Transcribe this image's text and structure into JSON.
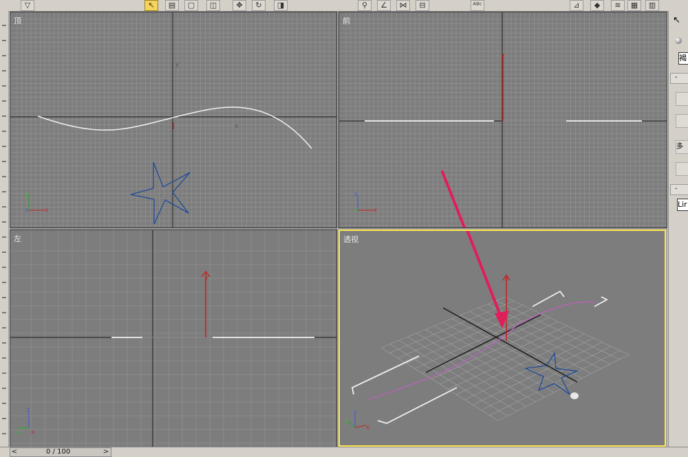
{
  "toolbar": {
    "buttons": [
      {
        "name": "select-filter-icon",
        "glyph": "▽"
      },
      {
        "name": "select-object-icon",
        "glyph": "↖"
      },
      {
        "name": "select-by-name-icon",
        "glyph": "▤"
      },
      {
        "name": "rect-selection-icon",
        "glyph": "▢"
      },
      {
        "name": "window-crossing-icon",
        "glyph": "◫"
      },
      {
        "name": "move-icon",
        "glyph": "✥"
      },
      {
        "name": "rotate-icon",
        "glyph": "↻"
      },
      {
        "name": "scale-icon",
        "glyph": "◨"
      },
      {
        "name": "snap-icon",
        "glyph": "⚲"
      },
      {
        "name": "angle-snap-icon",
        "glyph": "∠"
      },
      {
        "name": "mirror-icon",
        "glyph": "⋈"
      },
      {
        "name": "align-icon",
        "glyph": "⊟"
      },
      {
        "name": "spell-icon",
        "glyph": "ᴬᴮᶜ"
      },
      {
        "name": "curve-editor-icon",
        "glyph": "⊿"
      },
      {
        "name": "schematic-icon",
        "glyph": "◆"
      },
      {
        "name": "material-editor-icon",
        "glyph": "≋"
      },
      {
        "name": "render-setup-icon",
        "glyph": "▦"
      },
      {
        "name": "render-icon",
        "glyph": "▥"
      }
    ]
  },
  "viewports": {
    "top": {
      "label": "顶"
    },
    "front": {
      "label": "前"
    },
    "left": {
      "label": "左"
    },
    "perspective": {
      "label": "透视"
    }
  },
  "axis_labels": {
    "x": "x",
    "y": "y",
    "z": "z"
  },
  "command_panel": {
    "name_field": "褐",
    "rollout_1": "-",
    "rollout_2": "-",
    "row_text": "多",
    "list_item": "Lir"
  },
  "timeline": {
    "frame": "0 / 100",
    "prev": "<",
    "next": ">"
  },
  "colors": {
    "viewport_bg": "#7d7d7d",
    "grid": "#979797",
    "active_border": "#ffe850",
    "star": "#1e4a9a",
    "spline_white": "#f0f0f0",
    "spline_selected": "#c060c0",
    "arrow": "#e01e5a",
    "axis_red": "#c81e1e"
  }
}
